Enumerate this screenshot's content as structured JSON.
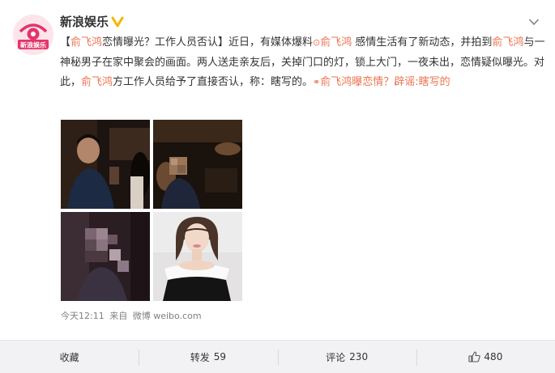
{
  "account": {
    "name": "新浪娱乐",
    "avatar_text": "新浪娱乐"
  },
  "post": {
    "segments": [
      {
        "text": "【",
        "hl": false
      },
      {
        "text": "俞飞鸿",
        "hl": true,
        "icon": "person-icon"
      },
      {
        "text": "恋情曝光？工作人员否认】近日，有媒体爆料",
        "hl": false
      },
      {
        "text": "俞飞鸿",
        "hl": true,
        "icon": "location-pin-icon"
      },
      {
        "text": " 感情生活有了新动态，并拍到",
        "hl": false
      },
      {
        "text": "俞飞鸿",
        "hl": true
      },
      {
        "text": "与一神秘男子在家中聚会的画面。两人送走亲友后，关掉门口的灯，锁上大门，一夜未出，恋情疑似曝光。对此，",
        "hl": false
      },
      {
        "text": "俞飞鸿",
        "hl": true
      },
      {
        "text": "方工作人员给予了直接否认，称：瞎写的。",
        "hl": false
      },
      {
        "text": "俞飞鸿曝恋情？辟谣:瞎写的",
        "hl": true,
        "icon": "link-icon"
      }
    ]
  },
  "meta": {
    "time": "今天12:11",
    "from_label": "来自",
    "source": "微博 weibo.com"
  },
  "actions": {
    "favorite": {
      "label": "收藏"
    },
    "repost": {
      "label": "转发",
      "count": "59"
    },
    "comment": {
      "label": "评论",
      "count": "230"
    },
    "like": {
      "count": "480"
    }
  },
  "colors": {
    "highlight": "#eb7350",
    "verified": "#f7b500",
    "action_bar": "#f2f2f5",
    "meta_text": "#808080"
  }
}
